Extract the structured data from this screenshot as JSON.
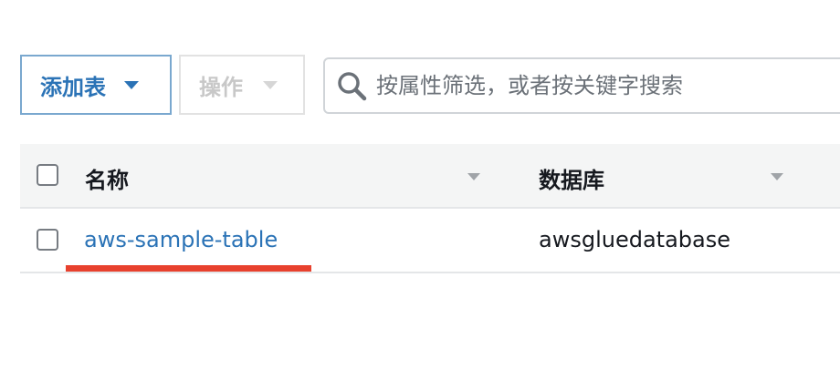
{
  "toolbar": {
    "add_table_label": "添加表",
    "actions_label": "操作"
  },
  "search": {
    "placeholder": "按属性筛选，或者按关键字搜索"
  },
  "table": {
    "columns": [
      "名称",
      "数据库"
    ],
    "rows": [
      {
        "name": "aws-sample-table",
        "database": "awsgluedatabase"
      }
    ]
  },
  "colors": {
    "link": "#2b73b6",
    "highlight_underline": "#e8412e"
  }
}
